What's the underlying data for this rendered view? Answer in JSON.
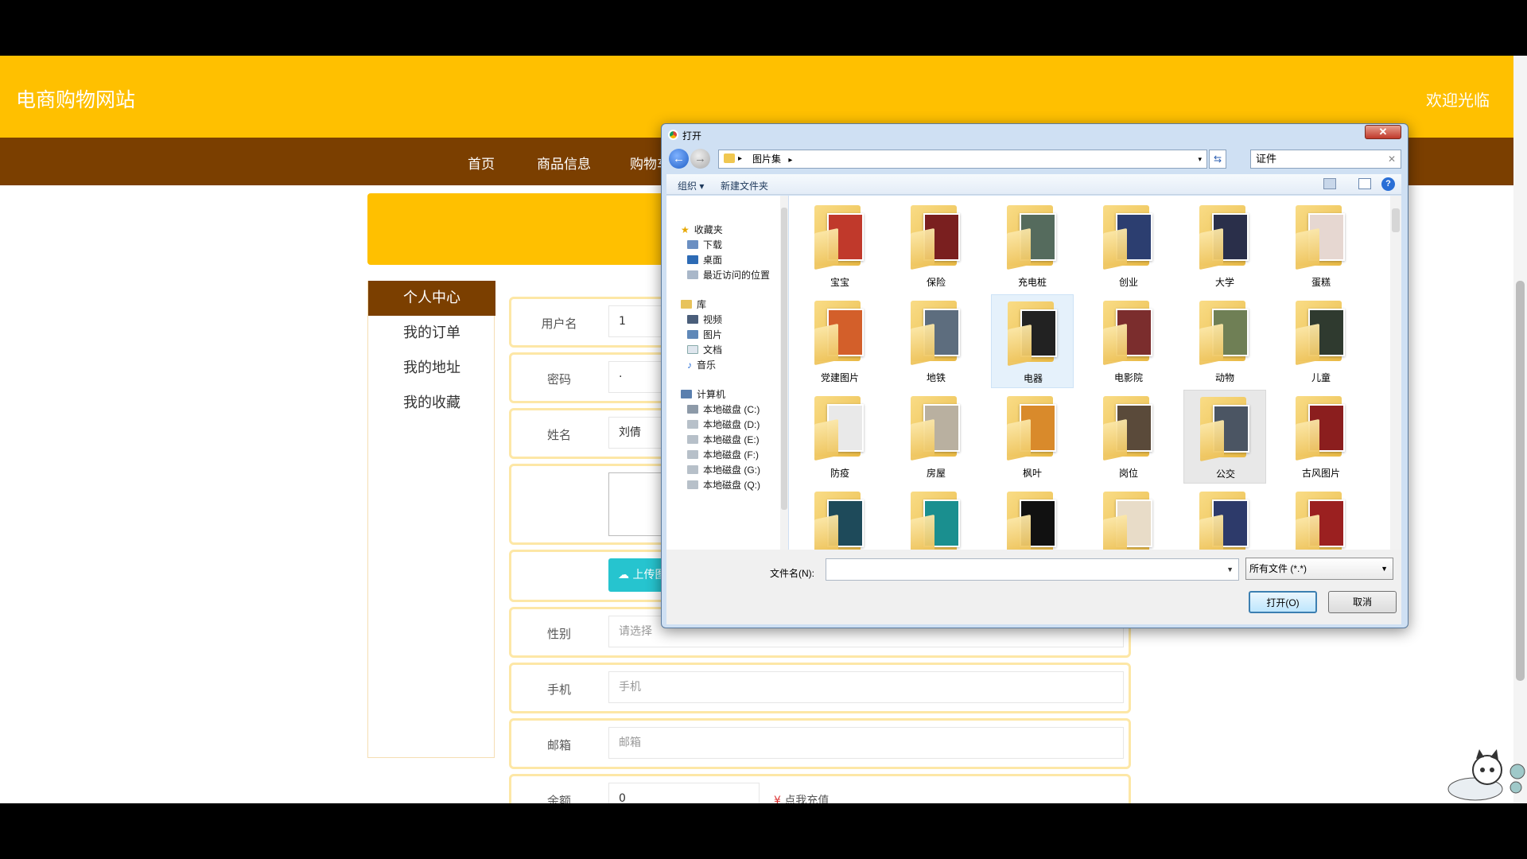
{
  "site": {
    "brand": "电商购物网站",
    "welcome": "欢迎光临",
    "nav": [
      "首页",
      "商品信息",
      "购物车"
    ]
  },
  "sidebar": {
    "items": [
      "个人中心",
      "我的订单",
      "我的地址",
      "我的收藏"
    ]
  },
  "form": {
    "username_label": "用户名",
    "username_value": "1",
    "password_label": "密码",
    "password_value": "·",
    "name_label": "姓名",
    "name_value": "刘倩",
    "upload_label": "上传图",
    "gender_label": "性别",
    "gender_placeholder": "请选择",
    "phone_label": "手机",
    "phone_placeholder": "手机",
    "email_label": "邮箱",
    "email_placeholder": "邮箱",
    "balance_label": "余额",
    "balance_value": "0",
    "recharge_label": "点我充值"
  },
  "dialog": {
    "title": "打开",
    "breadcrumb": "图片集",
    "search_value": "证件",
    "organize": "组织 ▾",
    "new_folder": "新建文件夹",
    "tree": {
      "favorites": "收藏夹",
      "downloads": "下载",
      "desktop": "桌面",
      "recent": "最近访问的位置",
      "libraries": "库",
      "videos": "视频",
      "pictures": "图片",
      "documents": "文档",
      "music": "音乐",
      "computer": "计算机",
      "drives": [
        "本地磁盘 (C:)",
        "本地磁盘 (D:)",
        "本地磁盘 (E:)",
        "本地磁盘 (F:)",
        "本地磁盘 (G:)",
        "本地磁盘 (Q:)"
      ]
    },
    "folders": [
      "宝宝",
      "保险",
      "充电桩",
      "创业",
      "大学",
      "蛋糕",
      "党建图片",
      "地铁",
      "电器",
      "电影院",
      "动物",
      "儿童",
      "防疫",
      "房屋",
      "枫叶",
      "岗位",
      "公交",
      "古风图片",
      "",
      "",
      "",
      "",
      "",
      ""
    ],
    "filename_label": "文件名(N):",
    "filetype": "所有文件 (*.*)",
    "open_button": "打开(O)",
    "cancel_button": "取消"
  },
  "colors": {
    "header": "#ffc000",
    "navbar": "#7b3f00",
    "upload": "#26c4cf"
  }
}
